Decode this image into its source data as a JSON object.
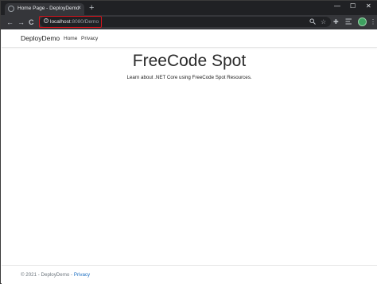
{
  "browser": {
    "tab_title": "Home Page - DeployDemo",
    "tab_close": "×",
    "new_tab": "+",
    "window_minimize": "—",
    "window_maximize": "☐",
    "window_close": "✕",
    "back": "←",
    "forward": "→",
    "reload": "C",
    "url_host": "localhost",
    "url_rest": ":8080/Demo",
    "url_highlight_color": "#d4141c"
  },
  "site": {
    "brand": "DeployDemo",
    "nav": [
      "Home",
      "Privacy"
    ],
    "title": "FreeCode Spot",
    "subtitle": "Learn about .NET Core using FreeCode Spot Resources.",
    "footer_text": "© 2021 - DeployDemo - ",
    "footer_link": "Privacy"
  }
}
